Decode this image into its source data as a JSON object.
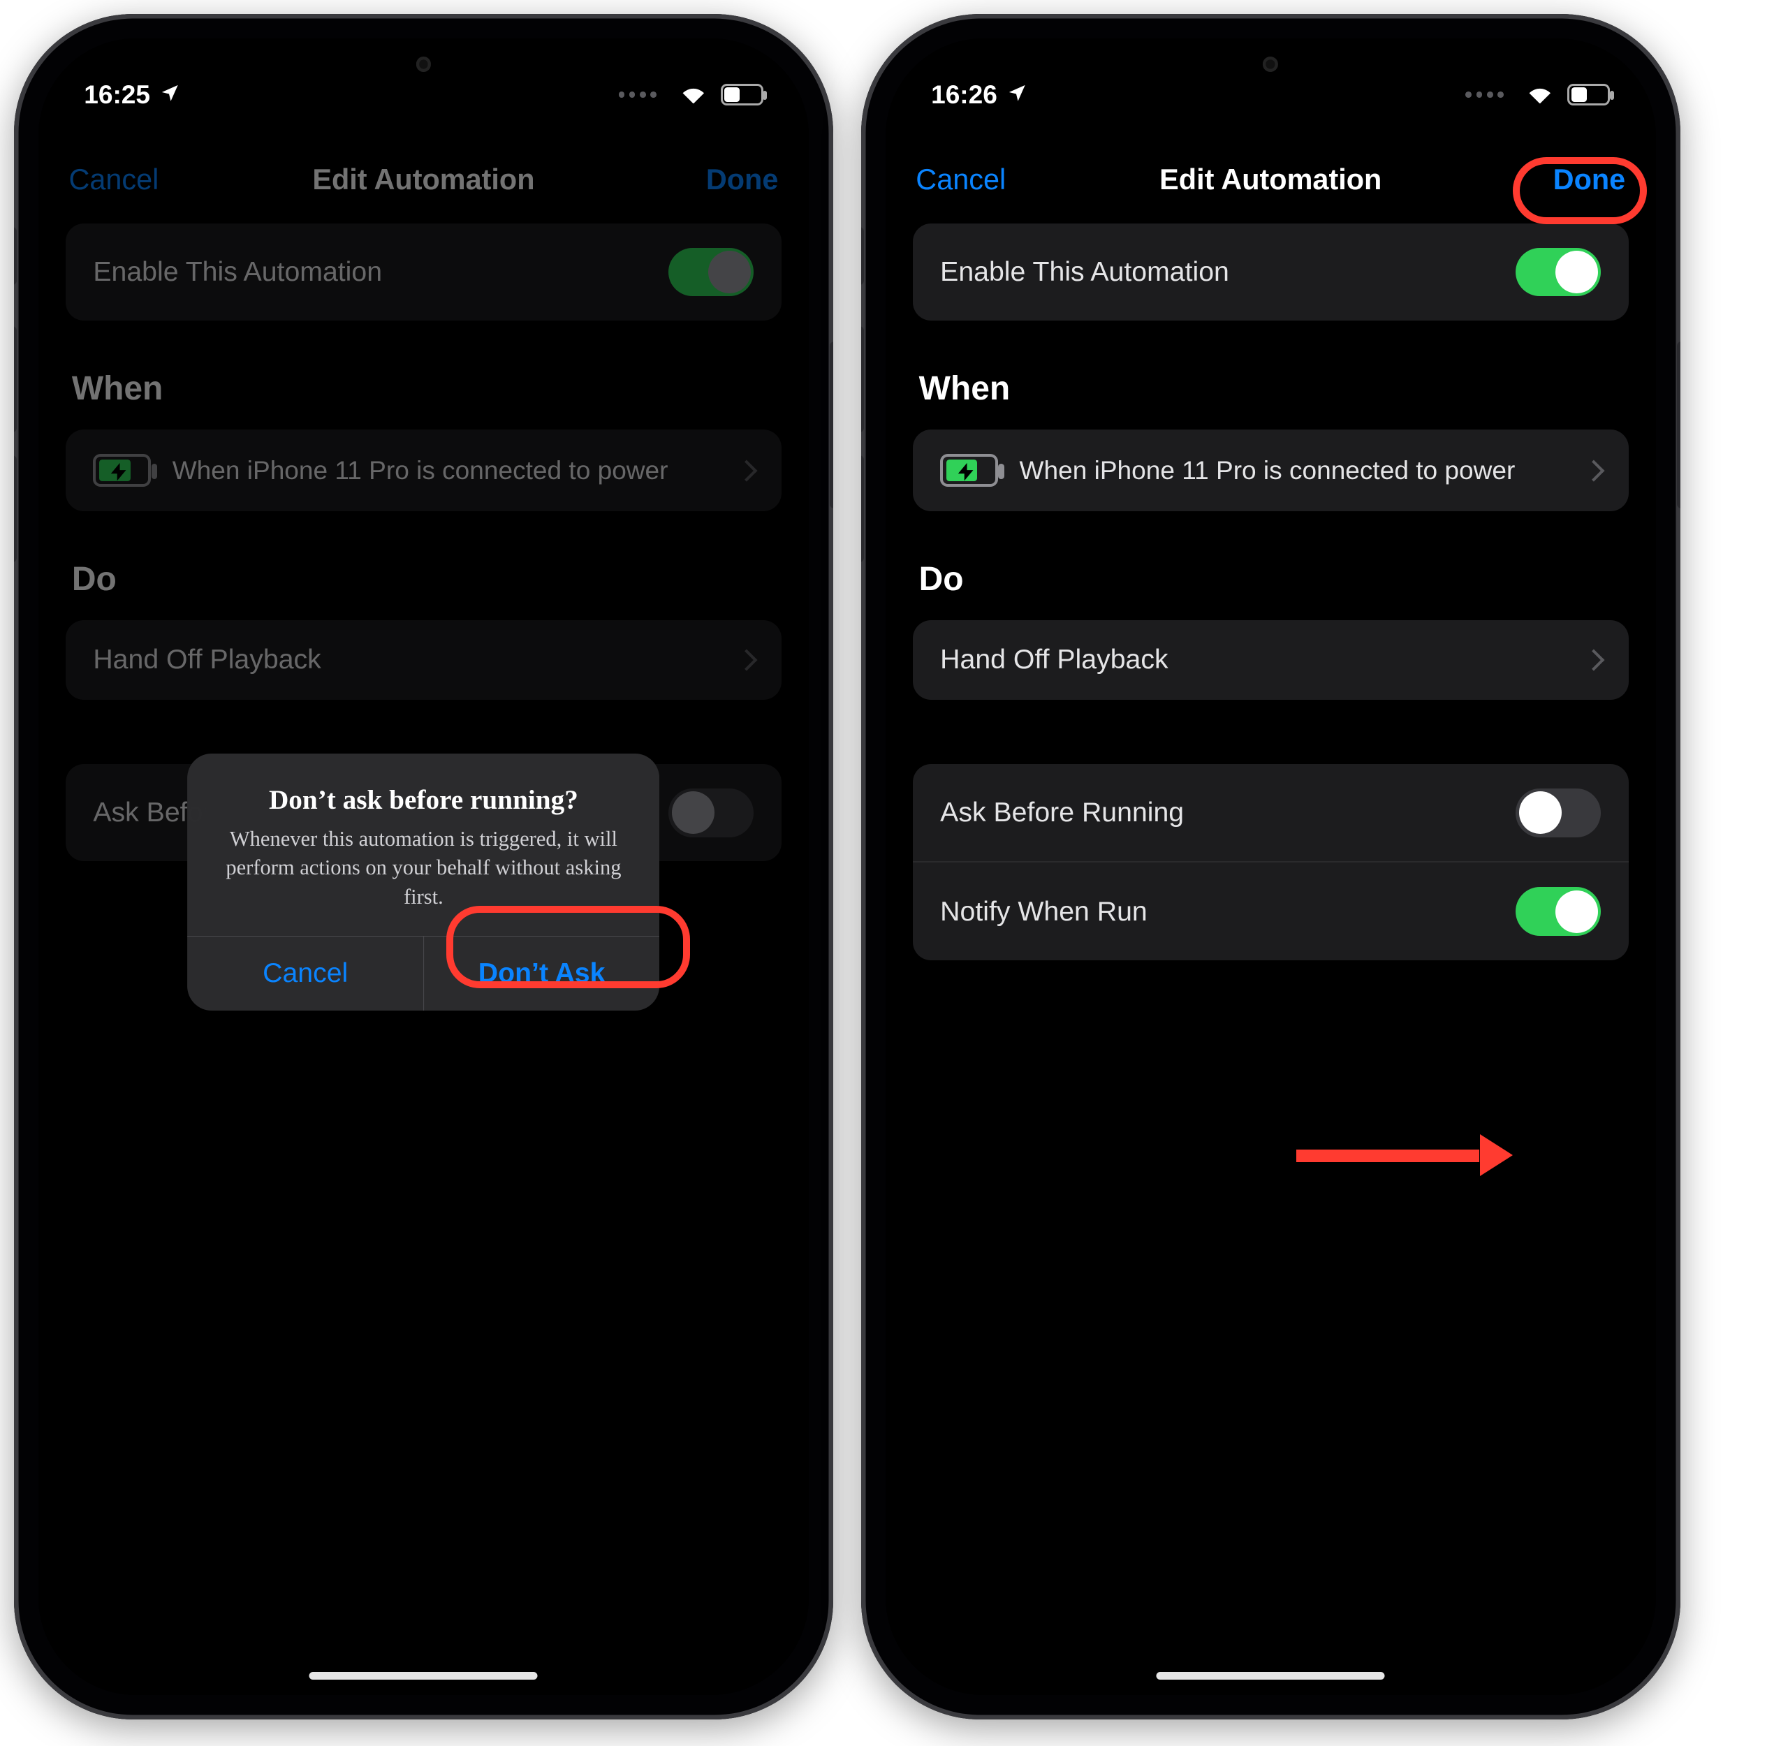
{
  "left": {
    "status": {
      "time": "16:25",
      "location_icon": "location-arrow"
    },
    "nav": {
      "cancel": "Cancel",
      "title": "Edit Automation",
      "done": "Done"
    },
    "enable": {
      "label": "Enable This Automation",
      "on": true
    },
    "when": {
      "heading": "When",
      "text": "When iPhone 11 Pro is connected to power"
    },
    "do": {
      "heading": "Do",
      "action": "Hand Off Playback"
    },
    "ask": {
      "label": "Ask Before Running",
      "on": false
    },
    "alert": {
      "title": "Don’t ask before running?",
      "message": "Whenever this automation is triggered, it will perform actions on your behalf without asking first.",
      "cancel": "Cancel",
      "confirm": "Don’t Ask"
    }
  },
  "right": {
    "status": {
      "time": "16:26",
      "location_icon": "location-arrow"
    },
    "nav": {
      "cancel": "Cancel",
      "title": "Edit Automation",
      "done": "Done"
    },
    "enable": {
      "label": "Enable This Automation",
      "on": true
    },
    "when": {
      "heading": "When",
      "text": "When iPhone 11 Pro is connected to power"
    },
    "do": {
      "heading": "Do",
      "action": "Hand Off Playback"
    },
    "ask": {
      "label": "Ask Before Running",
      "on": false
    },
    "notify": {
      "label": "Notify When Run",
      "on": true
    }
  }
}
